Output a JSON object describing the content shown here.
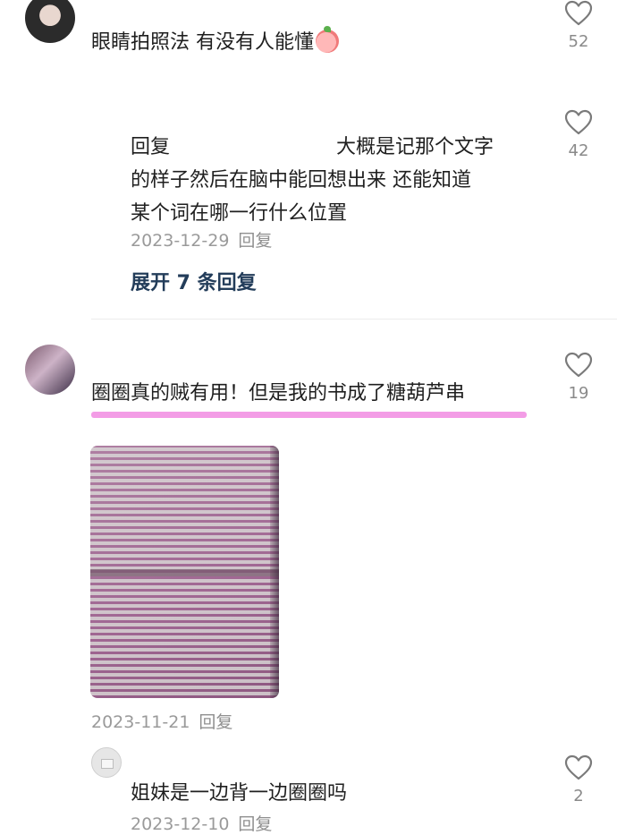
{
  "comments": [
    {
      "text": "眼睛拍照法 有没有人能懂",
      "emoji_icon": "peach-emoji-icon",
      "likes": "52"
    },
    {
      "reply_prefix": "回复",
      "reply_body_line1": "大概是记那个文字",
      "reply_body_line2": "的样子然后在脑中能回想出来 还能知道",
      "reply_body_line3": "某个词在哪一行什么位置",
      "date": "2023-12-29",
      "reply_label": "回复",
      "likes": "42",
      "expand_label": "展开 7 条回复"
    },
    {
      "text": "圈圈真的贼有用！但是我的书成了糖葫芦串",
      "highlight_color": "#f39ce6",
      "date": "2023-11-21",
      "reply_label": "回复",
      "likes": "19"
    },
    {
      "text": "姐妹是一边背一边圈圈吗",
      "date": "2023-12-10",
      "reply_label": "回复",
      "likes": "2"
    }
  ],
  "icons": {
    "like": "heart-outline-icon"
  }
}
